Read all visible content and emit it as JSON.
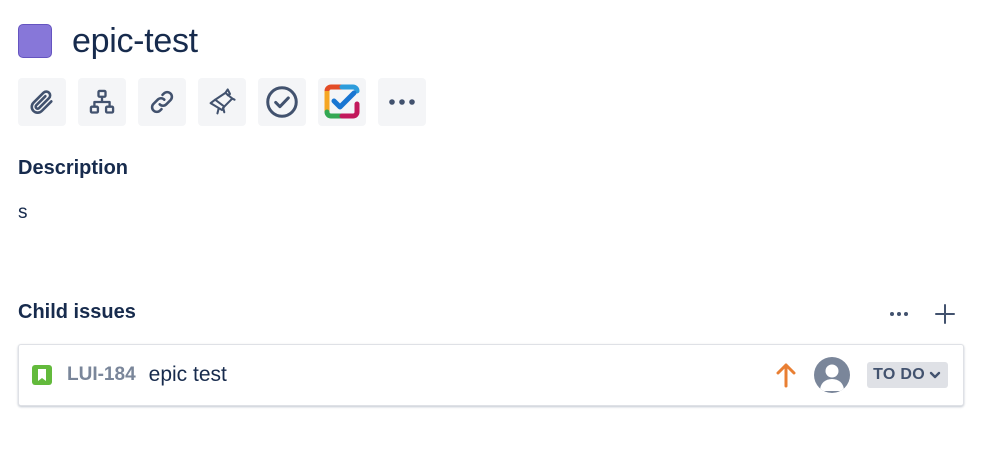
{
  "issue": {
    "title": "epic-test",
    "type_icon": "epic-icon",
    "type_color": "#8777D9"
  },
  "toolbar": {
    "buttons": [
      {
        "icon": "attachment-icon"
      },
      {
        "icon": "child-issue-icon"
      },
      {
        "icon": "link-icon"
      },
      {
        "icon": "confluence-icon"
      },
      {
        "icon": "checkmark-icon"
      },
      {
        "icon": "checklist-app-icon"
      },
      {
        "icon": "more-icon"
      }
    ]
  },
  "description": {
    "heading": "Description",
    "body": "s"
  },
  "child_issues": {
    "heading": "Child issues",
    "items": [
      {
        "key": "LUI-184",
        "summary": "epic test",
        "type_icon": "story-icon",
        "priority_icon": "priority-high-icon",
        "assignee_icon": "avatar-icon",
        "status": "TO DO"
      }
    ]
  },
  "colors": {
    "text_primary": "#172B4D",
    "text_subtle": "#7A869A",
    "story_green": "#63BA3C",
    "priority_orange": "#E97F33",
    "button_bg": "#F4F5F7",
    "lozenge_bg": "#DFE1E6"
  }
}
